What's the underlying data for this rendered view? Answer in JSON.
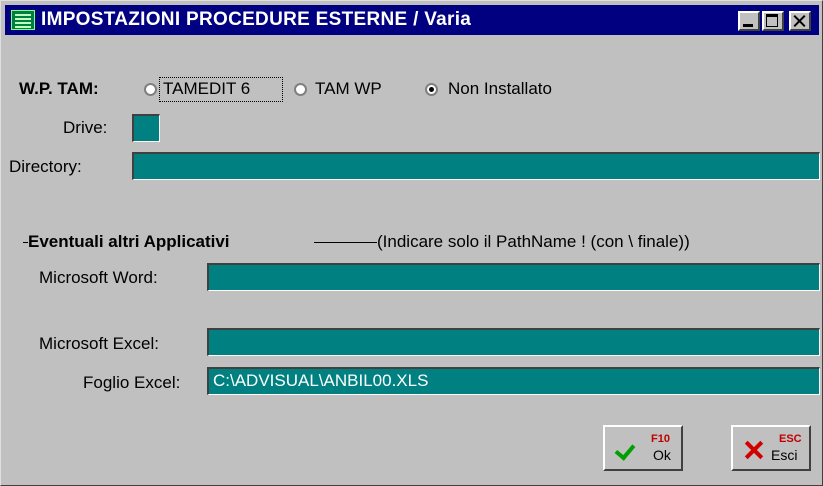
{
  "window": {
    "title": "IMPOSTAZIONI PROCEDURE ESTERNE / Varia",
    "icon": "app-grid-icon"
  },
  "wp_tam": {
    "label": "W.P. TAM:",
    "options": [
      {
        "label": "TAMEDIT 6",
        "selected": false
      },
      {
        "label": "TAM WP",
        "selected": false
      },
      {
        "label": "Non Installato",
        "selected": true
      }
    ]
  },
  "drive": {
    "label": "Drive:",
    "value": ""
  },
  "directory": {
    "label": "Directory:",
    "value": ""
  },
  "others": {
    "heading": "Eventuali altri Applicativi",
    "hint": "(Indicare solo il PathName ! (con \\ finale))"
  },
  "word": {
    "label": "Microsoft Word:",
    "value": ""
  },
  "excel": {
    "label": "Microsoft Excel:",
    "value": ""
  },
  "foglio": {
    "label": "Foglio Excel:",
    "value": "C:\\ADVISUAL\\ANBIL00.XLS"
  },
  "buttons": {
    "ok": {
      "key": "F10",
      "label": "Ok",
      "icon": "checkmark-icon"
    },
    "esci": {
      "key": "ESC",
      "label": "Esci",
      "icon": "x-icon"
    }
  },
  "colors": {
    "field_bg": "#008080",
    "title_bg": "#000080",
    "window_bg": "#c0c0c0"
  }
}
